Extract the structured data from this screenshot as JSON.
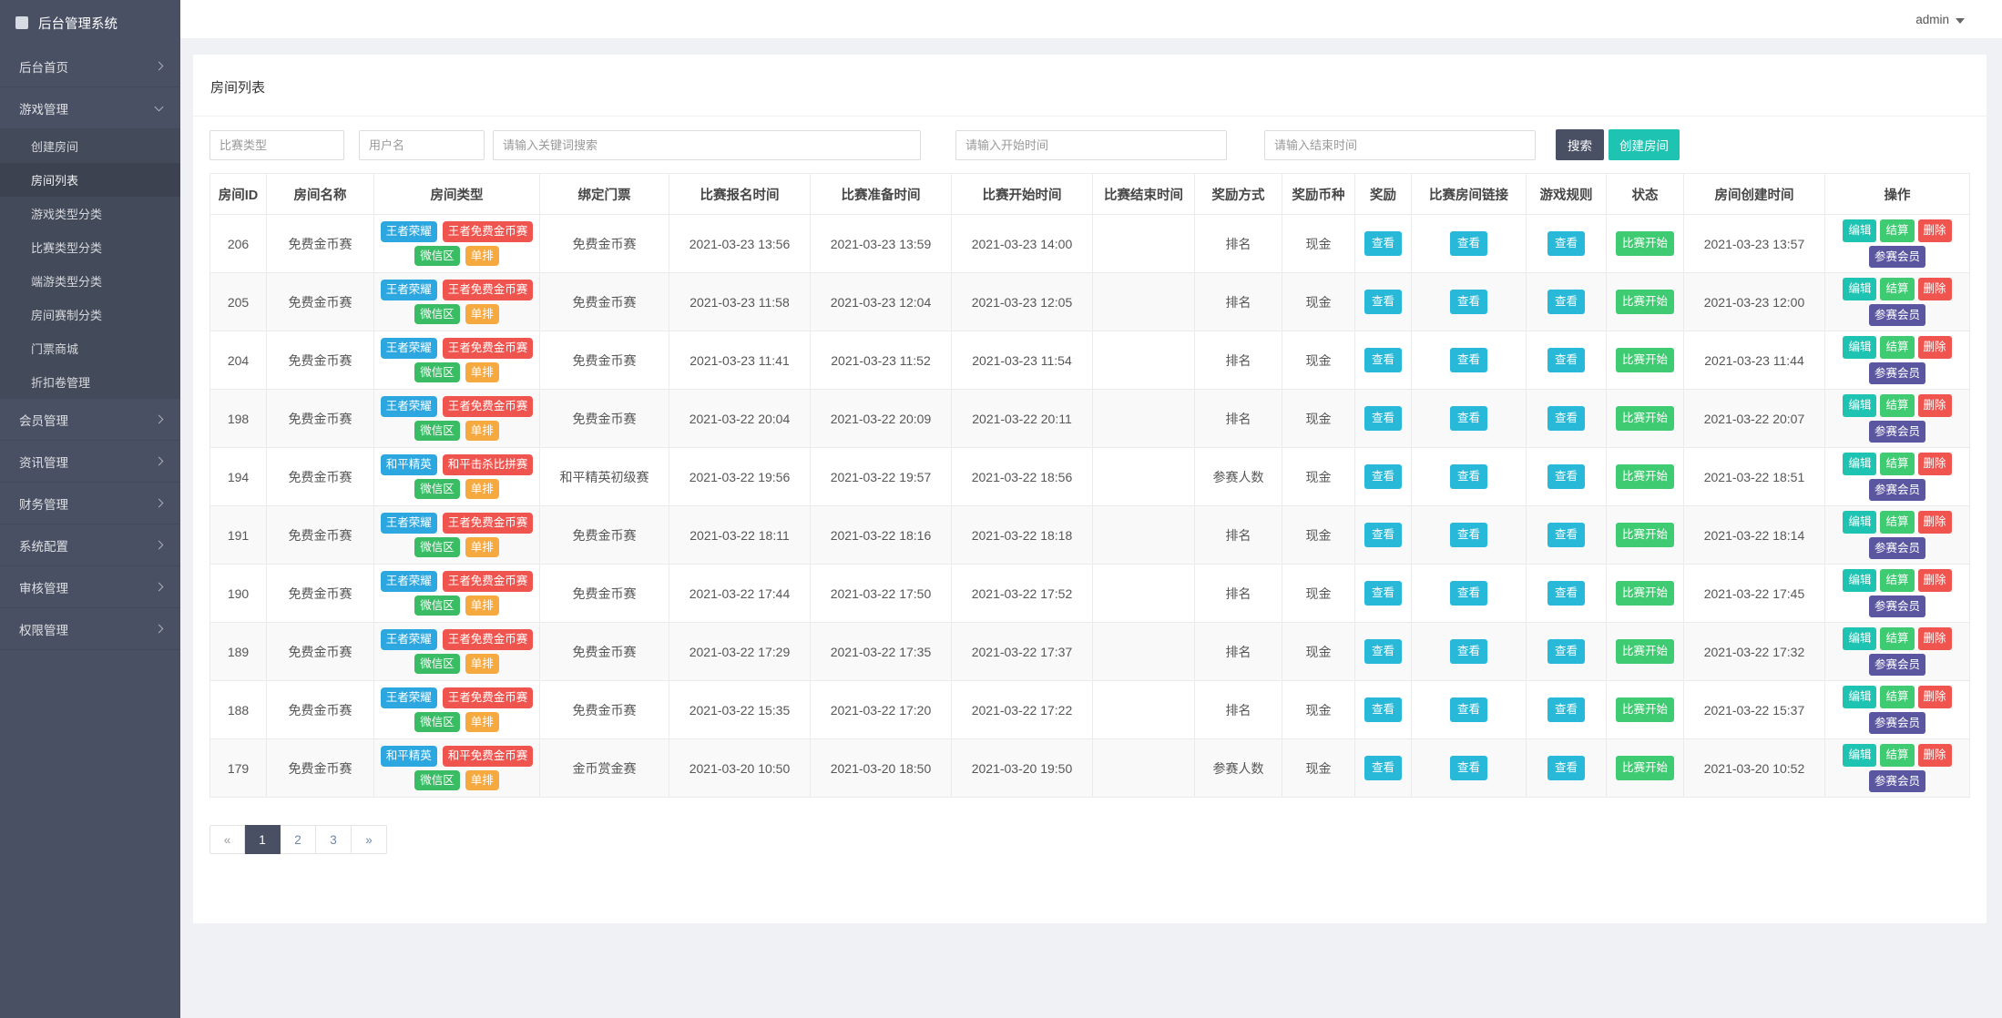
{
  "brand": {
    "title": "后台管理系统"
  },
  "topbar": {
    "user": "admin"
  },
  "sidebar": {
    "items": [
      {
        "label": "后台首页",
        "open": false
      },
      {
        "label": "游戏管理",
        "open": true,
        "children": [
          "创建房间",
          "房间列表",
          "游戏类型分类",
          "比赛类型分类",
          "端游类型分类",
          "房间赛制分类",
          "门票商城",
          "折扣卷管理"
        ],
        "active_child": "房间列表"
      },
      {
        "label": "会员管理",
        "open": false
      },
      {
        "label": "资讯管理",
        "open": false
      },
      {
        "label": "财务管理",
        "open": false
      },
      {
        "label": "系统配置",
        "open": false
      },
      {
        "label": "审核管理",
        "open": false
      },
      {
        "label": "权限管理",
        "open": false
      }
    ]
  },
  "page": {
    "title": "房间列表"
  },
  "filters": {
    "match_type_placeholder": "比赛类型",
    "username_placeholder": "用户名",
    "keyword_placeholder": "请输入关键词搜索",
    "start_placeholder": "请输入开始时间",
    "end_placeholder": "请输入结束时间",
    "search_label": "搜索",
    "create_label": "创建房间"
  },
  "table": {
    "headers": [
      "房间ID",
      "房间名称",
      "房间类型",
      "绑定门票",
      "比赛报名时间",
      "比赛准备时间",
      "比赛开始时间",
      "比赛结束时间",
      "奖励方式",
      "奖励币种",
      "奖励",
      "比赛房间链接",
      "游戏规则",
      "状态",
      "房间创建时间",
      "操作"
    ],
    "view_label": "查看",
    "status_label": "比赛开始",
    "action_labels": [
      "编辑",
      "结算",
      "删除",
      "参赛会员"
    ],
    "rows": [
      {
        "id": "206",
        "name": "免费金币赛",
        "tags": [
          {
            "text": "王者荣耀",
            "color": "blue"
          },
          {
            "text": "王者免费金币赛",
            "color": "red"
          },
          {
            "text": "微信区",
            "color": "green"
          },
          {
            "text": "单排",
            "color": "orange"
          }
        ],
        "ticket": "免费金币赛",
        "signup": "2021-03-23 13:56",
        "prepare": "2021-03-23 13:59",
        "start": "2021-03-23 14:00",
        "end": "",
        "reward_mode": "排名",
        "currency": "现金",
        "created": "2021-03-23 13:57"
      },
      {
        "id": "205",
        "name": "免费金币赛",
        "tags": [
          {
            "text": "王者荣耀",
            "color": "blue"
          },
          {
            "text": "王者免费金币赛",
            "color": "red"
          },
          {
            "text": "微信区",
            "color": "green"
          },
          {
            "text": "单排",
            "color": "orange"
          }
        ],
        "ticket": "免费金币赛",
        "signup": "2021-03-23 11:58",
        "prepare": "2021-03-23 12:04",
        "start": "2021-03-23 12:05",
        "end": "",
        "reward_mode": "排名",
        "currency": "现金",
        "created": "2021-03-23 12:00"
      },
      {
        "id": "204",
        "name": "免费金币赛",
        "tags": [
          {
            "text": "王者荣耀",
            "color": "blue"
          },
          {
            "text": "王者免费金币赛",
            "color": "red"
          },
          {
            "text": "微信区",
            "color": "green"
          },
          {
            "text": "单排",
            "color": "orange"
          }
        ],
        "ticket": "免费金币赛",
        "signup": "2021-03-23 11:41",
        "prepare": "2021-03-23 11:52",
        "start": "2021-03-23 11:54",
        "end": "",
        "reward_mode": "排名",
        "currency": "现金",
        "created": "2021-03-23 11:44"
      },
      {
        "id": "198",
        "name": "免费金币赛",
        "tags": [
          {
            "text": "王者荣耀",
            "color": "blue"
          },
          {
            "text": "王者免费金币赛",
            "color": "red"
          },
          {
            "text": "微信区",
            "color": "green"
          },
          {
            "text": "单排",
            "color": "orange"
          }
        ],
        "ticket": "免费金币赛",
        "signup": "2021-03-22 20:04",
        "prepare": "2021-03-22 20:09",
        "start": "2021-03-22 20:11",
        "end": "",
        "reward_mode": "排名",
        "currency": "现金",
        "created": "2021-03-22 20:07"
      },
      {
        "id": "194",
        "name": "免费金币赛",
        "tags": [
          {
            "text": "和平精英",
            "color": "blue"
          },
          {
            "text": "和平击杀比拼赛",
            "color": "red"
          },
          {
            "text": "微信区",
            "color": "green"
          },
          {
            "text": "单排",
            "color": "orange"
          }
        ],
        "ticket": "和平精英初级赛",
        "signup": "2021-03-22 19:56",
        "prepare": "2021-03-22 19:57",
        "start": "2021-03-22 18:56",
        "end": "",
        "reward_mode": "参赛人数",
        "currency": "现金",
        "created": "2021-03-22 18:51"
      },
      {
        "id": "191",
        "name": "免费金币赛",
        "tags": [
          {
            "text": "王者荣耀",
            "color": "blue"
          },
          {
            "text": "王者免费金币赛",
            "color": "red"
          },
          {
            "text": "微信区",
            "color": "green"
          },
          {
            "text": "单排",
            "color": "orange"
          }
        ],
        "ticket": "免费金币赛",
        "signup": "2021-03-22 18:11",
        "prepare": "2021-03-22 18:16",
        "start": "2021-03-22 18:18",
        "end": "",
        "reward_mode": "排名",
        "currency": "现金",
        "created": "2021-03-22 18:14"
      },
      {
        "id": "190",
        "name": "免费金币赛",
        "tags": [
          {
            "text": "王者荣耀",
            "color": "blue"
          },
          {
            "text": "王者免费金币赛",
            "color": "red"
          },
          {
            "text": "微信区",
            "color": "green"
          },
          {
            "text": "单排",
            "color": "orange"
          }
        ],
        "ticket": "免费金币赛",
        "signup": "2021-03-22 17:44",
        "prepare": "2021-03-22 17:50",
        "start": "2021-03-22 17:52",
        "end": "",
        "reward_mode": "排名",
        "currency": "现金",
        "created": "2021-03-22 17:45"
      },
      {
        "id": "189",
        "name": "免费金币赛",
        "tags": [
          {
            "text": "王者荣耀",
            "color": "blue"
          },
          {
            "text": "王者免费金币赛",
            "color": "red"
          },
          {
            "text": "微信区",
            "color": "green"
          },
          {
            "text": "单排",
            "color": "orange"
          }
        ],
        "ticket": "免费金币赛",
        "signup": "2021-03-22 17:29",
        "prepare": "2021-03-22 17:35",
        "start": "2021-03-22 17:37",
        "end": "",
        "reward_mode": "排名",
        "currency": "现金",
        "created": "2021-03-22 17:32"
      },
      {
        "id": "188",
        "name": "免费金币赛",
        "tags": [
          {
            "text": "王者荣耀",
            "color": "blue"
          },
          {
            "text": "王者免费金币赛",
            "color": "red"
          },
          {
            "text": "微信区",
            "color": "green"
          },
          {
            "text": "单排",
            "color": "orange"
          }
        ],
        "ticket": "免费金币赛",
        "signup": "2021-03-22 15:35",
        "prepare": "2021-03-22 17:20",
        "start": "2021-03-22 17:22",
        "end": "",
        "reward_mode": "排名",
        "currency": "现金",
        "created": "2021-03-22 15:37"
      },
      {
        "id": "179",
        "name": "免费金币赛",
        "tags": [
          {
            "text": "和平精英",
            "color": "blue"
          },
          {
            "text": "和平免费金币赛",
            "color": "red"
          },
          {
            "text": "微信区",
            "color": "green"
          },
          {
            "text": "单排",
            "color": "orange"
          }
        ],
        "ticket": "金币赏金赛",
        "signup": "2021-03-20 10:50",
        "prepare": "2021-03-20 18:50",
        "start": "2021-03-20 19:50",
        "end": "",
        "reward_mode": "参赛人数",
        "currency": "现金",
        "created": "2021-03-20 10:52"
      }
    ]
  },
  "pagination": {
    "items": [
      "«",
      "1",
      "2",
      "3",
      "»"
    ],
    "active": "1"
  }
}
